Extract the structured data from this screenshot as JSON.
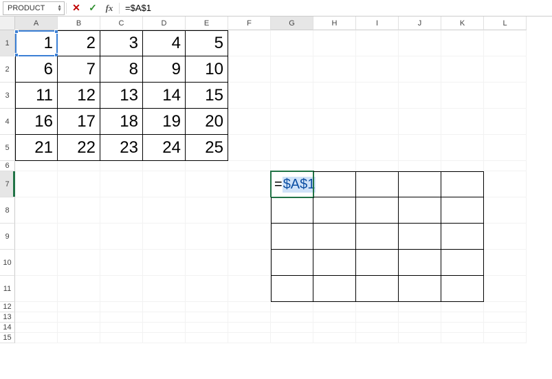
{
  "formula_bar": {
    "name_box": "PRODUCT",
    "fx_label": "fx",
    "formula": "=$A$1"
  },
  "columns": [
    "A",
    "B",
    "C",
    "D",
    "E",
    "F",
    "G",
    "H",
    "I",
    "J",
    "K",
    "L"
  ],
  "active_columns": [
    "A",
    "G"
  ],
  "rows": [
    {
      "n": "1",
      "h": "tall",
      "active": false,
      "ref": true
    },
    {
      "n": "2",
      "h": "tall",
      "active": false,
      "ref": false
    },
    {
      "n": "3",
      "h": "tall",
      "active": false,
      "ref": false
    },
    {
      "n": "4",
      "h": "tall",
      "active": false,
      "ref": false
    },
    {
      "n": "5",
      "h": "tall",
      "active": false,
      "ref": false
    },
    {
      "n": "6",
      "h": "thin",
      "active": false,
      "ref": false
    },
    {
      "n": "7",
      "h": "tall",
      "active": true,
      "ref": false
    },
    {
      "n": "8",
      "h": "tall",
      "active": false,
      "ref": false
    },
    {
      "n": "9",
      "h": "tall",
      "active": false,
      "ref": false
    },
    {
      "n": "10",
      "h": "tall",
      "active": false,
      "ref": false
    },
    {
      "n": "11",
      "h": "tall",
      "active": false,
      "ref": false
    },
    {
      "n": "12",
      "h": "thin",
      "active": false,
      "ref": false
    },
    {
      "n": "13",
      "h": "thin",
      "active": false,
      "ref": false
    },
    {
      "n": "14",
      "h": "thin",
      "active": false,
      "ref": false
    },
    {
      "n": "15",
      "h": "thin",
      "active": false,
      "ref": false
    }
  ],
  "block1": {
    "range": "A1:E5",
    "values": [
      [
        "1",
        "2",
        "3",
        "4",
        "5"
      ],
      [
        "6",
        "7",
        "8",
        "9",
        "10"
      ],
      [
        "11",
        "12",
        "13",
        "14",
        "15"
      ],
      [
        "16",
        "17",
        "18",
        "19",
        "20"
      ],
      [
        "21",
        "22",
        "23",
        "24",
        "25"
      ]
    ]
  },
  "block2": {
    "range": "G7:K11"
  },
  "editing_cell": {
    "address": "G7",
    "prefix": "=",
    "ref_text": "$A$1"
  },
  "referenced_cell": "A1",
  "colors": {
    "ref_border": "#3a7fd5",
    "edit_border": "#217346"
  }
}
